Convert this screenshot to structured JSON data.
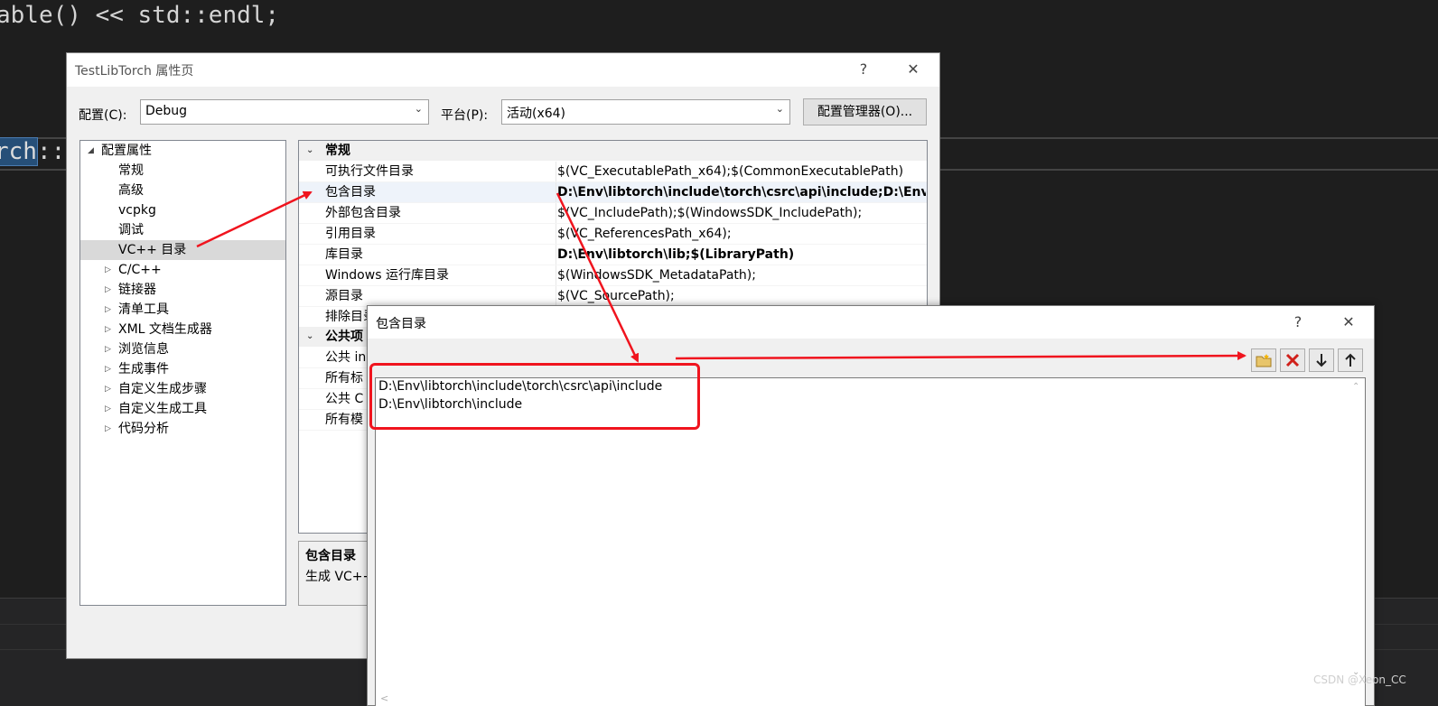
{
  "editor": {
    "line1": "able() << std::endl;",
    "line2_sel": "rch",
    "line2_rest": "::"
  },
  "main_dialog": {
    "title": "TestLibTorch 属性页",
    "help": "?",
    "close": "✕",
    "config_label": "配置(C):",
    "config_value": "Debug",
    "platform_label": "平台(P):",
    "platform_value": "活动(x64)",
    "config_manager": "配置管理器(O)...",
    "tree": [
      "配置属性",
      "常规",
      "高级",
      "vcpkg",
      "调试",
      "VC++ 目录",
      "C/C++",
      "链接器",
      "清单工具",
      "XML 文档生成器",
      "浏览信息",
      "生成事件",
      "自定义生成步骤",
      "自定义生成工具",
      "代码分析"
    ],
    "grid": {
      "cat_general": "常规",
      "rows": [
        {
          "name": "可执行文件目录",
          "value": "$(VC_ExecutablePath_x64);$(CommonExecutablePath)"
        },
        {
          "name": "包含目录",
          "value": "D:\\Env\\libtorch\\include\\torch\\csrc\\api\\include;D:\\Env\\l"
        },
        {
          "name": "外部包含目录",
          "value": "$(VC_IncludePath);$(WindowsSDK_IncludePath);"
        },
        {
          "name": "引用目录",
          "value": "$(VC_ReferencesPath_x64);"
        },
        {
          "name": "库目录",
          "value": "D:\\Env\\libtorch\\lib;$(LibraryPath)"
        },
        {
          "name": "Windows 运行库目录",
          "value": "$(WindowsSDK_MetadataPath);"
        },
        {
          "name": "源目录",
          "value": "$(VC_SourcePath);"
        },
        {
          "name": "排除目录",
          "value": ""
        }
      ],
      "cat_public": "公共项",
      "rows2": [
        "公共 in",
        "所有标",
        "公共 C",
        "所有模"
      ]
    },
    "desc_title": "包含目录",
    "desc_text": "生成 VC++"
  },
  "sub_dialog": {
    "title": "包含目录",
    "help": "?",
    "close": "✕",
    "items": [
      "D:\\Env\\libtorch\\include\\torch\\csrc\\api\\include",
      "D:\\Env\\libtorch\\include"
    ]
  },
  "watermark": "CSDN @Xeon_CC",
  "colors": {
    "annotation_red": "#f0141e",
    "selection": "#d9d9d9"
  }
}
